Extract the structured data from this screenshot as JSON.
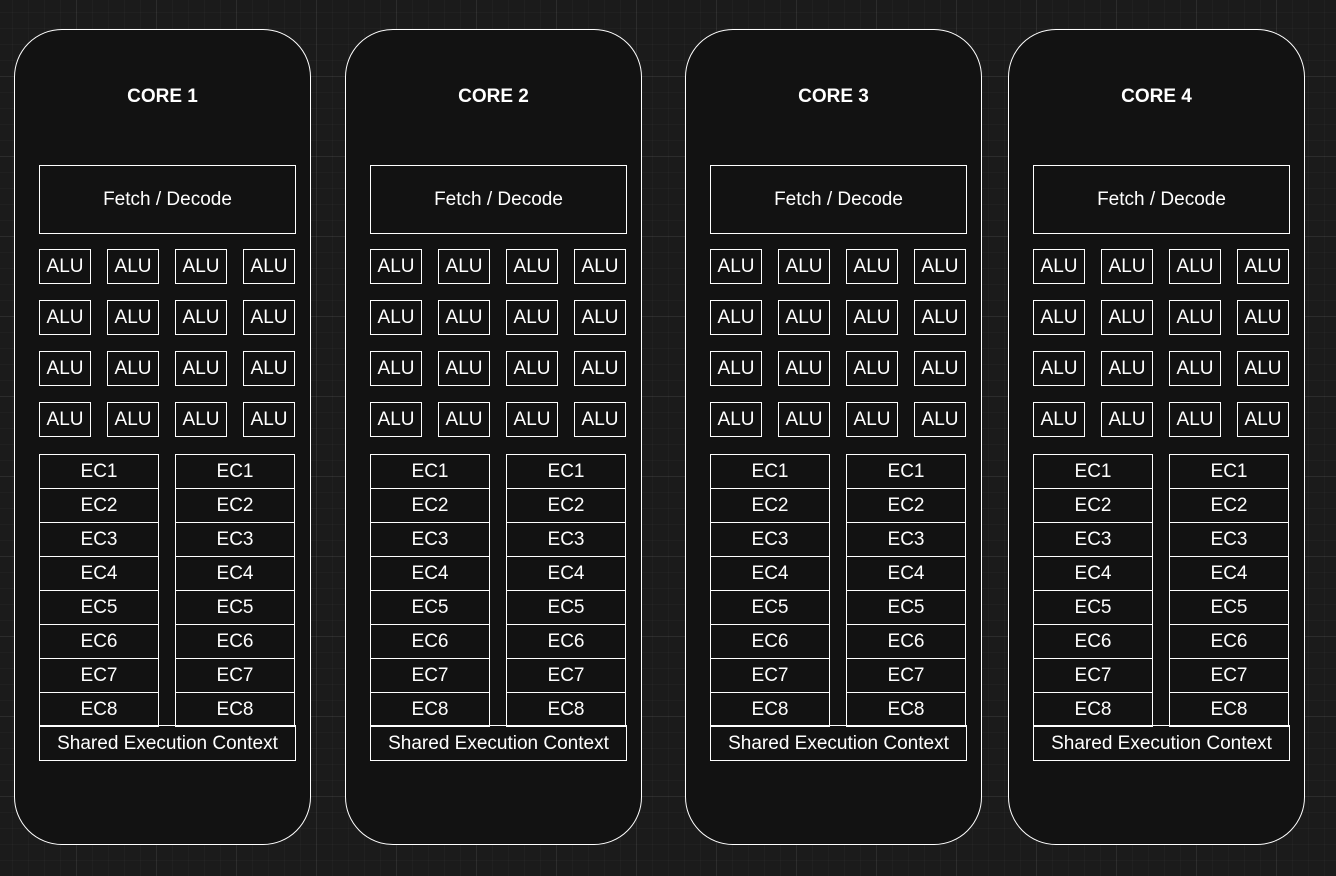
{
  "cores": [
    {
      "title": "CORE 1",
      "fetch_decode": "Fetch / Decode",
      "alu_label": "ALU",
      "ec_left": [
        "EC1",
        "EC2",
        "EC3",
        "EC4",
        "EC5",
        "EC6",
        "EC7",
        "EC8"
      ],
      "ec_right": [
        "EC1",
        "EC2",
        "EC3",
        "EC4",
        "EC5",
        "EC6",
        "EC7",
        "EC8"
      ],
      "shared_context": "Shared Execution Context"
    },
    {
      "title": "CORE 2",
      "fetch_decode": "Fetch / Decode",
      "alu_label": "ALU",
      "ec_left": [
        "EC1",
        "EC2",
        "EC3",
        "EC4",
        "EC5",
        "EC6",
        "EC7",
        "EC8"
      ],
      "ec_right": [
        "EC1",
        "EC2",
        "EC3",
        "EC4",
        "EC5",
        "EC6",
        "EC7",
        "EC8"
      ],
      "shared_context": "Shared Execution Context"
    },
    {
      "title": "CORE 3",
      "fetch_decode": "Fetch / Decode",
      "alu_label": "ALU",
      "ec_left": [
        "EC1",
        "EC2",
        "EC3",
        "EC4",
        "EC5",
        "EC6",
        "EC7",
        "EC8"
      ],
      "ec_right": [
        "EC1",
        "EC2",
        "EC3",
        "EC4",
        "EC5",
        "EC6",
        "EC7",
        "EC8"
      ],
      "shared_context": "Shared Execution Context"
    },
    {
      "title": "CORE 4",
      "fetch_decode": "Fetch / Decode",
      "alu_label": "ALU",
      "ec_left": [
        "EC1",
        "EC2",
        "EC3",
        "EC4",
        "EC5",
        "EC6",
        "EC7",
        "EC8"
      ],
      "ec_right": [
        "EC1",
        "EC2",
        "EC3",
        "EC4",
        "EC5",
        "EC6",
        "EC7",
        "EC8"
      ],
      "shared_context": "Shared Execution Context"
    }
  ],
  "alu_grid": {
    "rows": 4,
    "cols": 4
  },
  "colors": {
    "background": "#1b1b1b",
    "core_fill": "#121212",
    "stroke": "#ffffff",
    "text": "#ffffff"
  }
}
